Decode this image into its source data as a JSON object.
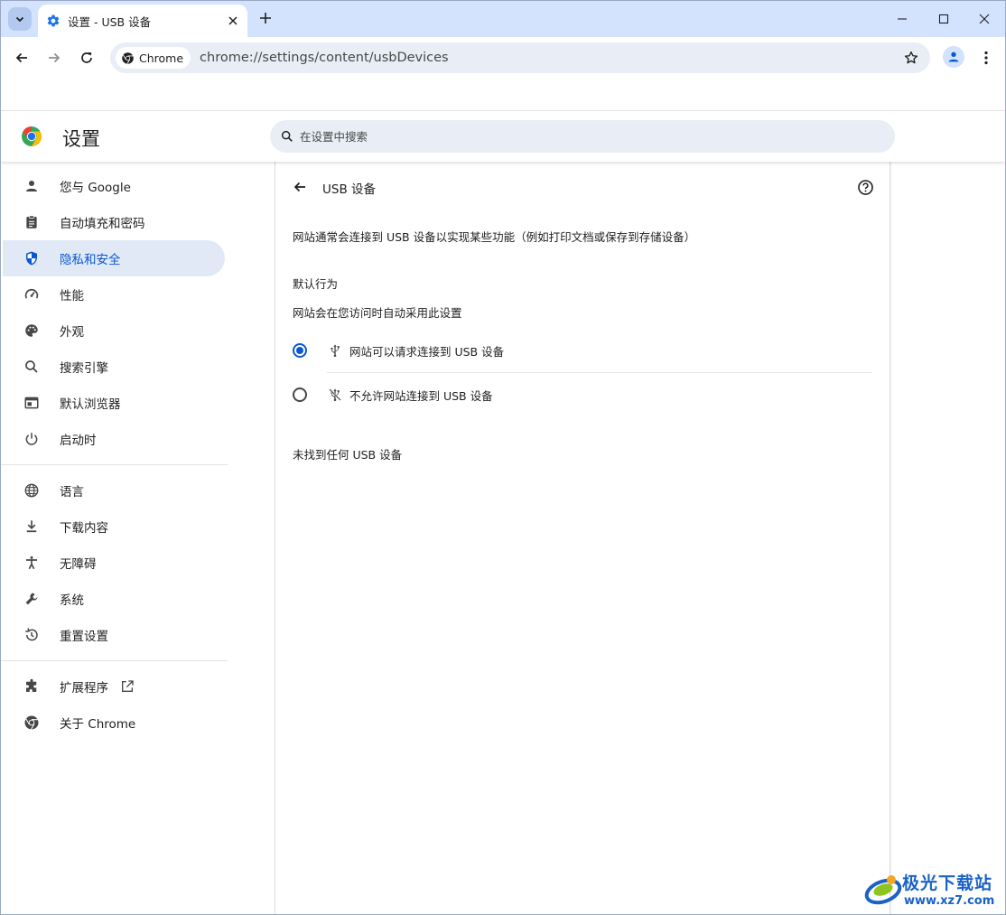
{
  "tab": {
    "title": "设置 - USB 设备",
    "favicon": "settings-gear-icon"
  },
  "toolbar": {
    "chip_label": "Chrome",
    "url": "chrome://settings/content/usbDevices"
  },
  "header": {
    "title": "设置",
    "search_placeholder": "在设置中搜索"
  },
  "sidebar": {
    "items": [
      {
        "label": "您与 Google",
        "icon": "person-icon"
      },
      {
        "label": "自动填充和密码",
        "icon": "clipboard-icon"
      },
      {
        "label": "隐私和安全",
        "icon": "shield-icon",
        "active": true
      },
      {
        "label": "性能",
        "icon": "speedometer-icon"
      },
      {
        "label": "外观",
        "icon": "palette-icon"
      },
      {
        "label": "搜索引擎",
        "icon": "search-icon"
      },
      {
        "label": "默认浏览器",
        "icon": "browser-icon"
      },
      {
        "label": "启动时",
        "icon": "power-icon"
      },
      {
        "label": "语言",
        "icon": "globe-icon"
      },
      {
        "label": "下载内容",
        "icon": "download-icon"
      },
      {
        "label": "无障碍",
        "icon": "accessibility-icon"
      },
      {
        "label": "系统",
        "icon": "wrench-icon"
      },
      {
        "label": "重置设置",
        "icon": "history-icon"
      },
      {
        "label": "扩展程序",
        "icon": "puzzle-icon"
      },
      {
        "label": "关于 Chrome",
        "icon": "chrome-icon"
      }
    ]
  },
  "main": {
    "page_title": "USB 设备",
    "description": "网站通常会连接到 USB 设备以实现某些功能（例如打印文档或保存到存储设备）",
    "default_behavior_title": "默认行为",
    "default_behavior_subtitle": "网站会在您访问时自动采用此设置",
    "options": [
      {
        "label": "网站可以请求连接到 USB 设备",
        "checked": true,
        "icon": "usb-icon"
      },
      {
        "label": "不允许网站连接到 USB 设备",
        "checked": false,
        "icon": "usb-off-icon"
      }
    ],
    "empty_text": "未找到任何 USB 设备"
  },
  "watermark": {
    "name": "极光下载站",
    "site": "www.xz7.com"
  },
  "colors": {
    "accent": "#0b57d0",
    "tabstrip": "#d3e3fd",
    "active_nav_bg": "#e1e9f7"
  }
}
